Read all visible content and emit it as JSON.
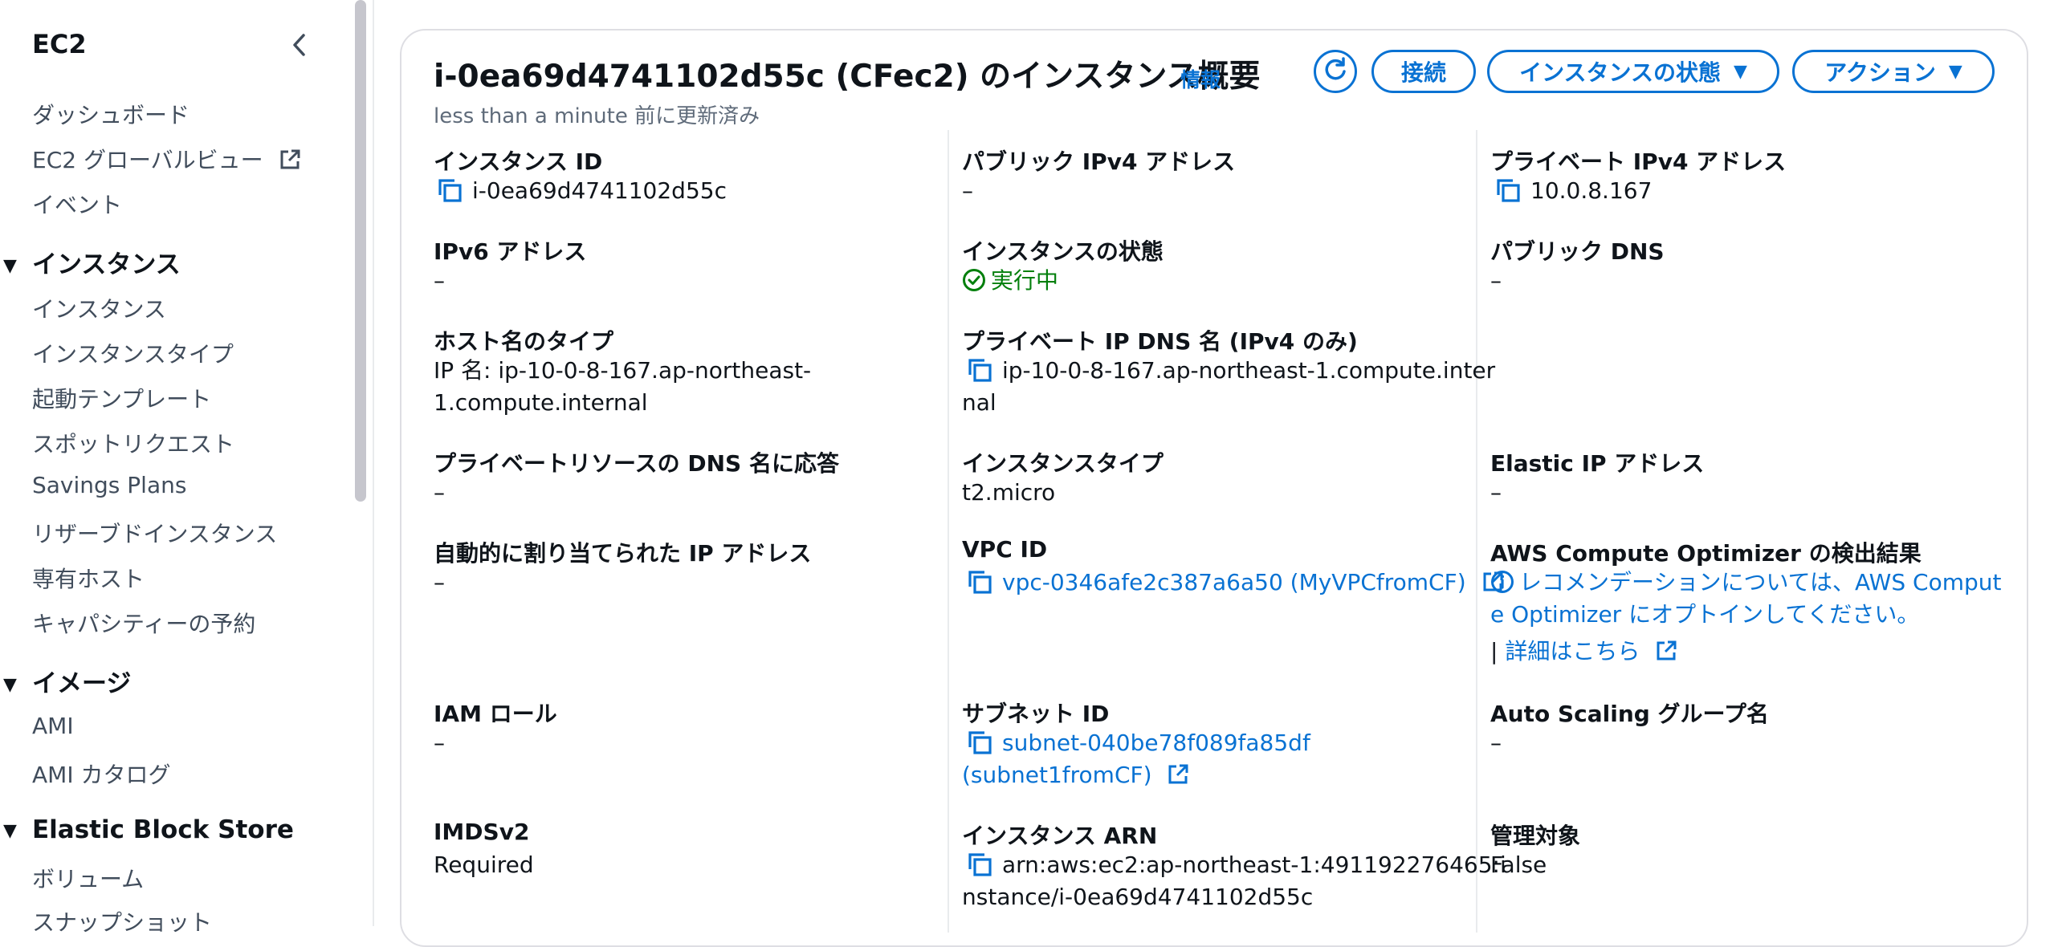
{
  "sidebar": {
    "title": "EC2",
    "top_items": [
      "ダッシュボード",
      "EC2 グローバルビュー",
      "イベント"
    ],
    "sections": [
      {
        "label": "インスタンス",
        "items": [
          "インスタンス",
          "インスタンスタイプ",
          "起動テンプレート",
          "スポットリクエスト",
          "Savings Plans",
          "リザーブドインスタンス",
          "専有ホスト",
          "キャパシティーの予約"
        ]
      },
      {
        "label": "イメージ",
        "items": [
          "AMI",
          "AMI カタログ"
        ]
      },
      {
        "label": "Elastic Block Store",
        "items": [
          "ボリューム",
          "スナップショット"
        ]
      }
    ]
  },
  "header": {
    "title": "i-0ea69d4741102d55c (CFec2) のインスタンス概要",
    "info": "情報",
    "subtitle": "less than a minute 前に更新済み",
    "buttons": {
      "connect": "接続",
      "instance_state": "インスタンスの状態",
      "actions": "アクション"
    }
  },
  "fields": {
    "instance_id": {
      "label": "インスタンス ID",
      "value": "i-0ea69d4741102d55c"
    },
    "public_ipv4": {
      "label": "パブリック IPv4 アドレス",
      "value": "–"
    },
    "private_ipv4": {
      "label": "プライベート IPv4 アドレス",
      "value": "10.0.8.167"
    },
    "ipv6": {
      "label": "IPv6 アドレス",
      "value": "–"
    },
    "instance_state": {
      "label": "インスタンスの状態",
      "value": "実行中"
    },
    "public_dns": {
      "label": "パブリック DNS",
      "value": "–"
    },
    "hostname_type": {
      "label": "ホスト名のタイプ",
      "value_line1": "IP 名: ip-10-0-8-167.ap-northeast-",
      "value_line2": "1.compute.internal"
    },
    "private_ip_dns": {
      "label": "プライベート IP DNS 名 (IPv4 のみ)",
      "value_line1": "ip-10-0-8-167.ap-northeast-1.compute.inter",
      "value_line2": "nal"
    },
    "resource_dns": {
      "label": "プライベートリソースの DNS 名に応答",
      "value": "–"
    },
    "instance_type": {
      "label": "インスタンスタイプ",
      "value": "t2.micro"
    },
    "elastic_ip": {
      "label": "Elastic IP アドレス",
      "value": "–"
    },
    "auto_ip": {
      "label": "自動的に割り当てられた IP アドレス",
      "value": "–"
    },
    "vpc_id": {
      "label": "VPC ID",
      "value": "vpc-0346afe2c387a6a50 (MyVPCfromCF)"
    },
    "optimizer": {
      "label": "AWS Compute Optimizer の検出結果",
      "line1": "レコメンデーションについては、AWS Comput",
      "line2": "e Optimizer にオプトインしてください。",
      "bar": "|",
      "detail_link": "詳細はこちら"
    },
    "iam_role": {
      "label": "IAM ロール",
      "value": "–"
    },
    "subnet_id": {
      "label": "サブネット ID",
      "value_line1": "subnet-040be78f089fa85df",
      "value_line2": "(subnet1fromCF)"
    },
    "asg_name": {
      "label": "Auto Scaling グループ名",
      "value": "–"
    },
    "imdsv2": {
      "label": "IMDSv2",
      "value": "Required"
    },
    "instance_arn": {
      "label": "インスタンス ARN",
      "value_line1": "arn:aws:ec2:ap-northeast-1:491192276465:i",
      "value_line2": "nstance/i-0ea69d4741102d55c"
    },
    "managed": {
      "label": "管理対象",
      "value": "False"
    }
  },
  "colors": {
    "accent": "#0972d3",
    "success": "#037f0c",
    "text": "#0f141a",
    "muted": "#5f6b7a"
  }
}
